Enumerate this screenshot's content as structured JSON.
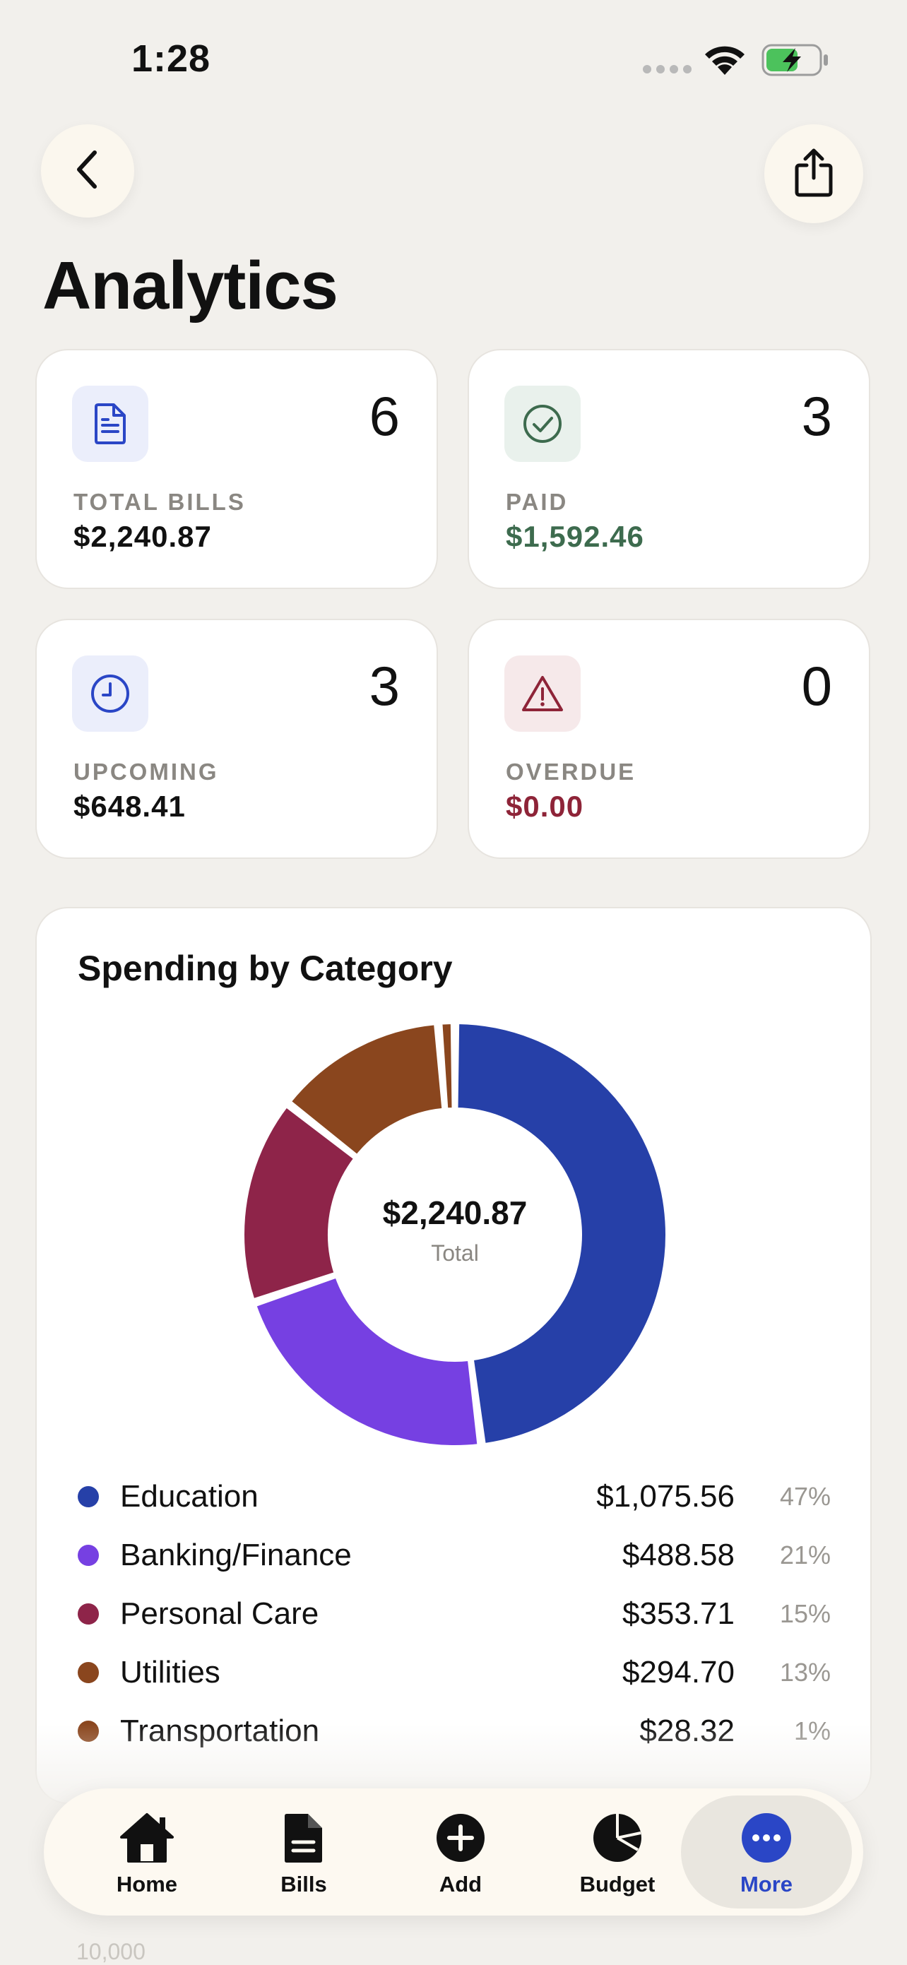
{
  "status_bar": {
    "time": "1:28"
  },
  "header": {
    "title": "Analytics"
  },
  "stats": [
    {
      "count": "6",
      "label": "TOTAL BILLS",
      "amount": "$2,240.87",
      "icon": "document-icon"
    },
    {
      "count": "3",
      "label": "PAID",
      "amount": "$1,592.46",
      "icon": "check-circle-icon"
    },
    {
      "count": "3",
      "label": "UPCOMING",
      "amount": "$648.41",
      "icon": "clock-icon"
    },
    {
      "count": "0",
      "label": "OVERDUE",
      "amount": "$0.00",
      "icon": "warning-icon"
    }
  ],
  "chart": {
    "title": "Spending by Category",
    "center_amount": "$2,240.87",
    "center_label": "Total"
  },
  "chart_data": {
    "type": "pie",
    "title": "Spending by Category",
    "categories": [
      "Education",
      "Banking/Finance",
      "Personal Care",
      "Utilities",
      "Transportation"
    ],
    "values": [
      1075.56,
      488.58,
      353.71,
      294.7,
      28.32
    ],
    "value_labels": [
      "$1,075.56",
      "$488.58",
      "$353.71",
      "$294.70",
      "$28.32"
    ],
    "percent_labels": [
      "47%",
      "21%",
      "15%",
      "13%",
      "1%"
    ],
    "colors": [
      "#2640a8",
      "#7640e2",
      "#8e2449",
      "#8a461e",
      "#8a461e"
    ]
  },
  "behind_text": "10,000",
  "tabbar": {
    "items": [
      {
        "label": "Home",
        "icon": "home-icon"
      },
      {
        "label": "Bills",
        "icon": "bills-icon"
      },
      {
        "label": "Add",
        "icon": "add-icon"
      },
      {
        "label": "Budget",
        "icon": "pie-chart-icon"
      },
      {
        "label": "More",
        "icon": "more-icon"
      }
    ]
  },
  "colors": {
    "accent": "#2a46c6",
    "paid_green": "#3d6b4e",
    "overdue_red": "#8e2438",
    "background": "#f2f0ec"
  }
}
